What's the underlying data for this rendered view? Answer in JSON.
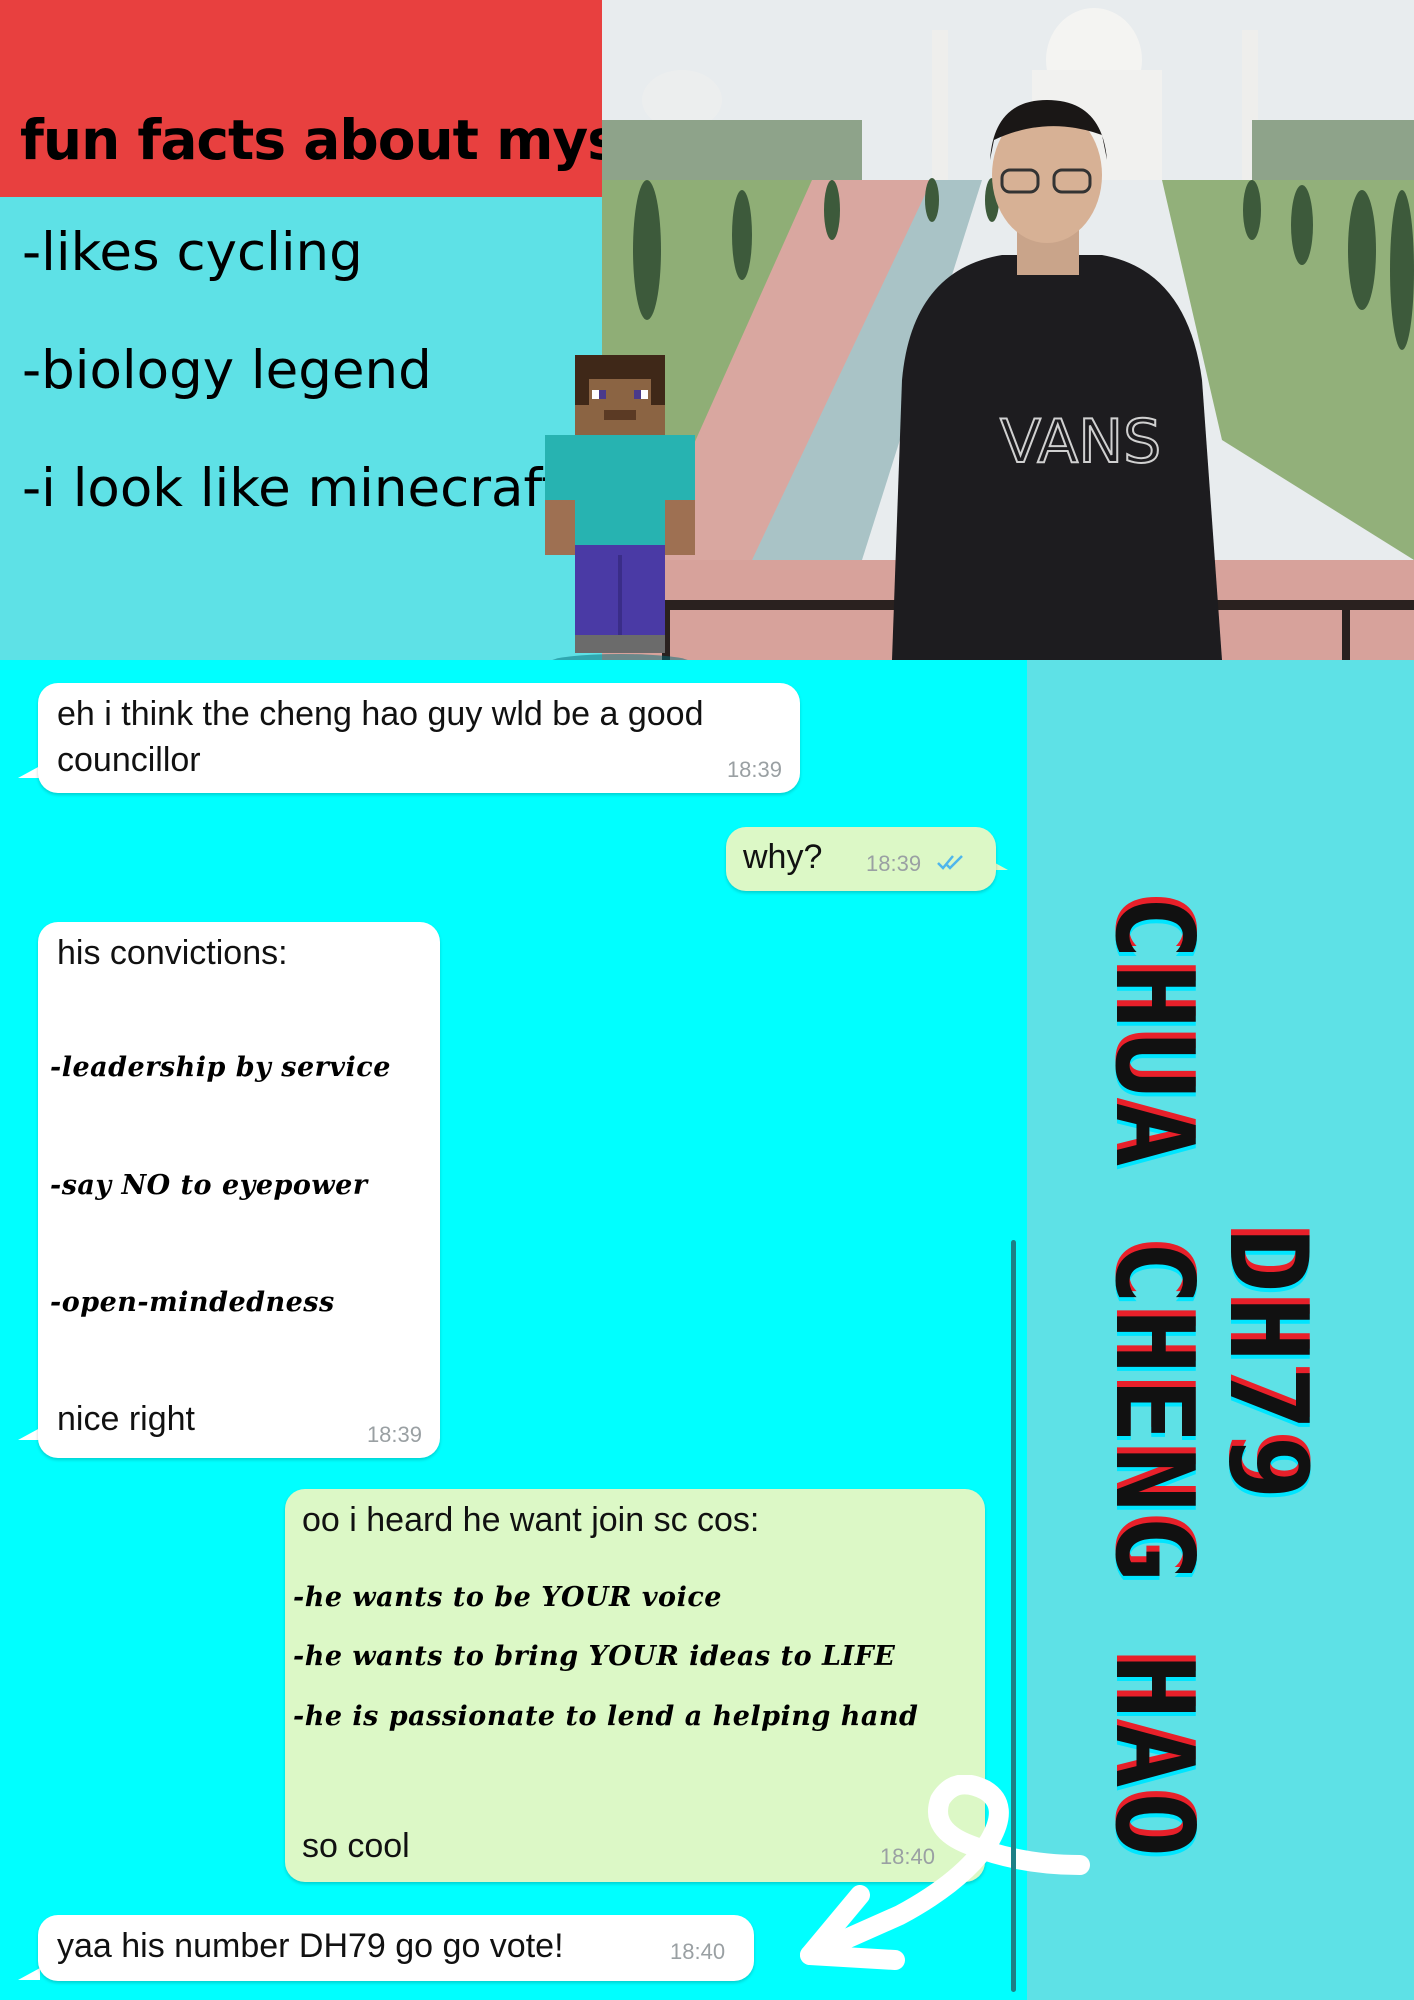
{
  "header": {
    "title": "fun facts about myself",
    "facts": [
      "-likes cycling",
      "-biology legend",
      "-i look like minecraft"
    ]
  },
  "photo": {
    "hoodie_text": "VANS"
  },
  "chat": {
    "m1": {
      "text_line1": "eh i think the cheng hao guy wld be a good",
      "text_line2": "councillor",
      "time": "18:39"
    },
    "m2": {
      "text": "why?",
      "time": "18:39",
      "status": "read"
    },
    "m3": {
      "heading": "his convictions:",
      "points": [
        "-leadership by service",
        "-say NO to eyepower",
        "-open-mindedness"
      ],
      "footer": "nice right",
      "time": "18:39"
    },
    "m4": {
      "heading": "oo i heard he want join sc cos:",
      "points": [
        "-he wants to be YOUR voice",
        "-he wants to bring YOUR ideas to LIFE",
        "-he is passionate to lend a helping hand"
      ],
      "footer": "so cool",
      "time": "18:40"
    },
    "m5": {
      "text": "yaa his number DH79 go go vote!",
      "time": "18:40"
    }
  },
  "candidate": {
    "line1": "CHUA CHENG HAO",
    "line2": "DH79"
  },
  "colors": {
    "title_bg": "#e8403f",
    "panel_bg": "#5ee1e6",
    "chat_bg": "#00ffff",
    "outgoing": "#dcf8c6",
    "incoming": "#ffffff",
    "name_shadow_red": "#e8202a"
  }
}
